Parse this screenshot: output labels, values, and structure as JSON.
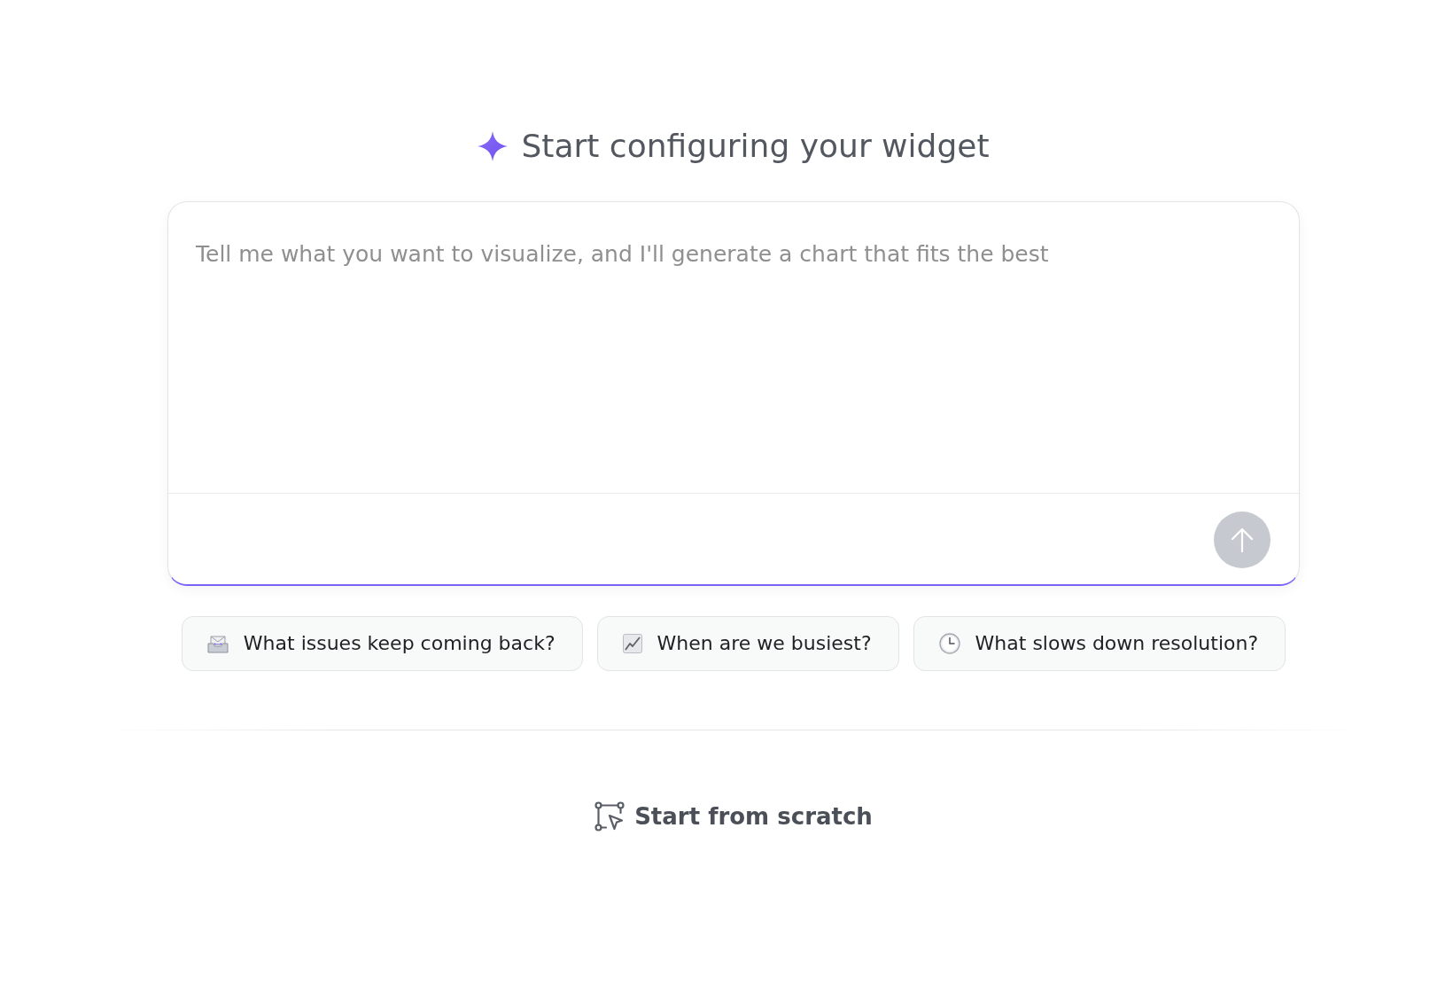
{
  "header": {
    "title": "Start configuring your widget"
  },
  "prompt": {
    "placeholder": "Tell me what you want to visualize, and I'll generate a chart that fits the best",
    "send_button": {
      "disabled": true
    }
  },
  "suggestions": [
    {
      "label": "What issues keep coming back?"
    },
    {
      "label": "When are we busiest?"
    },
    {
      "label": "What slows down resolution?"
    }
  ],
  "start_from_scratch": {
    "label": "Start from scratch"
  }
}
